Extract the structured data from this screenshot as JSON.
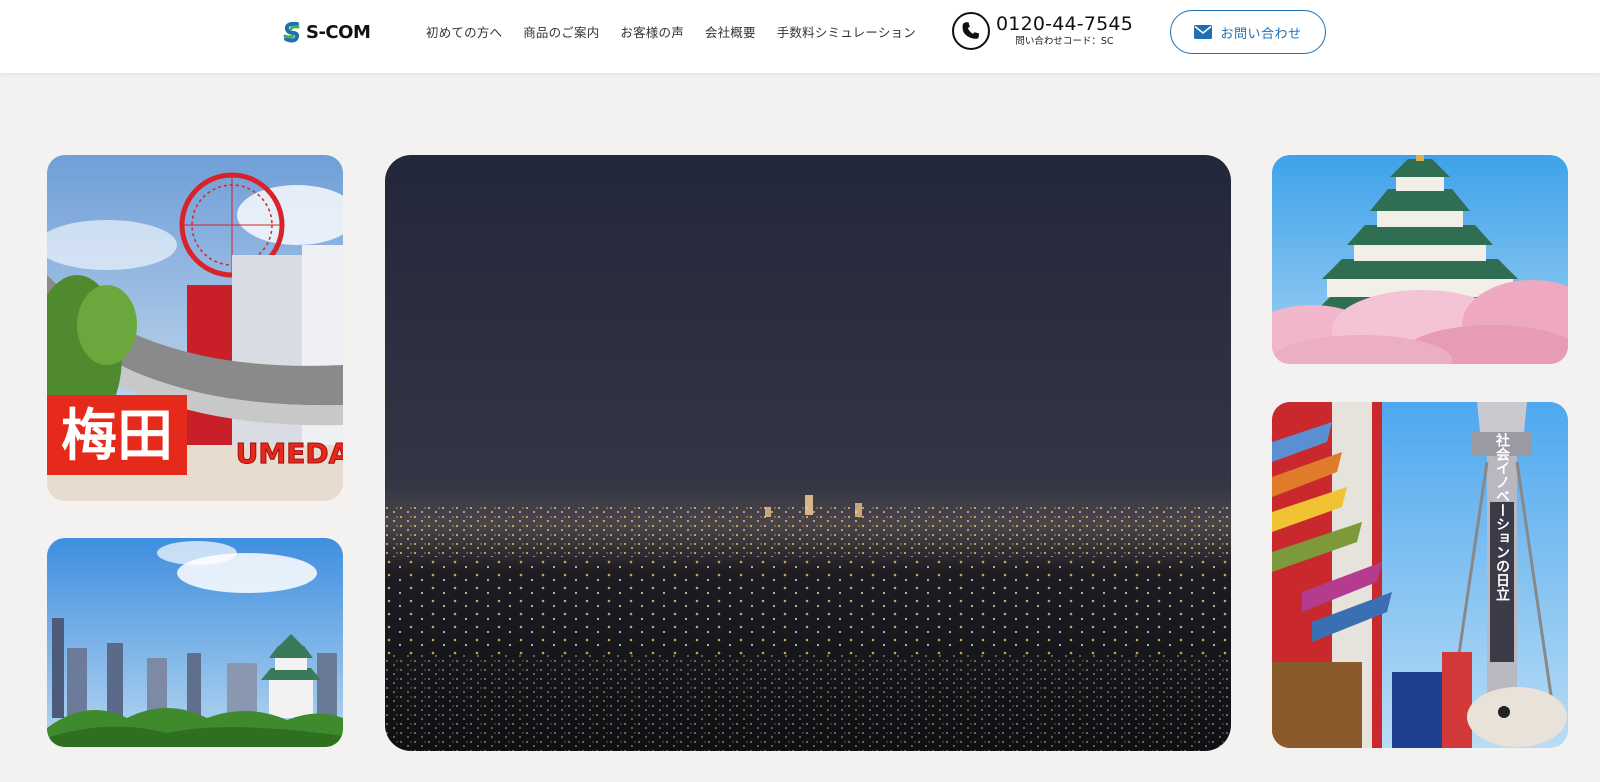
{
  "header": {
    "logo_text": "S-COM",
    "nav": [
      {
        "label": "初めての方へ"
      },
      {
        "label": "商品のご案内"
      },
      {
        "label": "お客様の声"
      },
      {
        "label": "会社概要"
      },
      {
        "label": "手数料シミュレーション"
      }
    ],
    "phone": {
      "number": "0120-44-7545",
      "code_label": "問い合わせコード：SC"
    },
    "contact_button": {
      "label": "お問い合わせ",
      "icon": "envelope-icon"
    }
  },
  "photos": [
    {
      "name": "umeda-ferris-wheel-photo",
      "signs": [
        "梅田",
        "UMEDA"
      ]
    },
    {
      "name": "osaka-skyline-castle-photo"
    },
    {
      "name": "city-night-view-photo"
    },
    {
      "name": "osaka-castle-cherry-blossom-photo"
    },
    {
      "name": "tsutenkaku-tower-photo",
      "tower_sign": "社会イノベーションの日立"
    }
  ],
  "colors": {
    "accent": "#1f6fb2",
    "page_bg": "#f4f2f1",
    "header_bg": "#ffffff",
    "text": "#333333"
  }
}
